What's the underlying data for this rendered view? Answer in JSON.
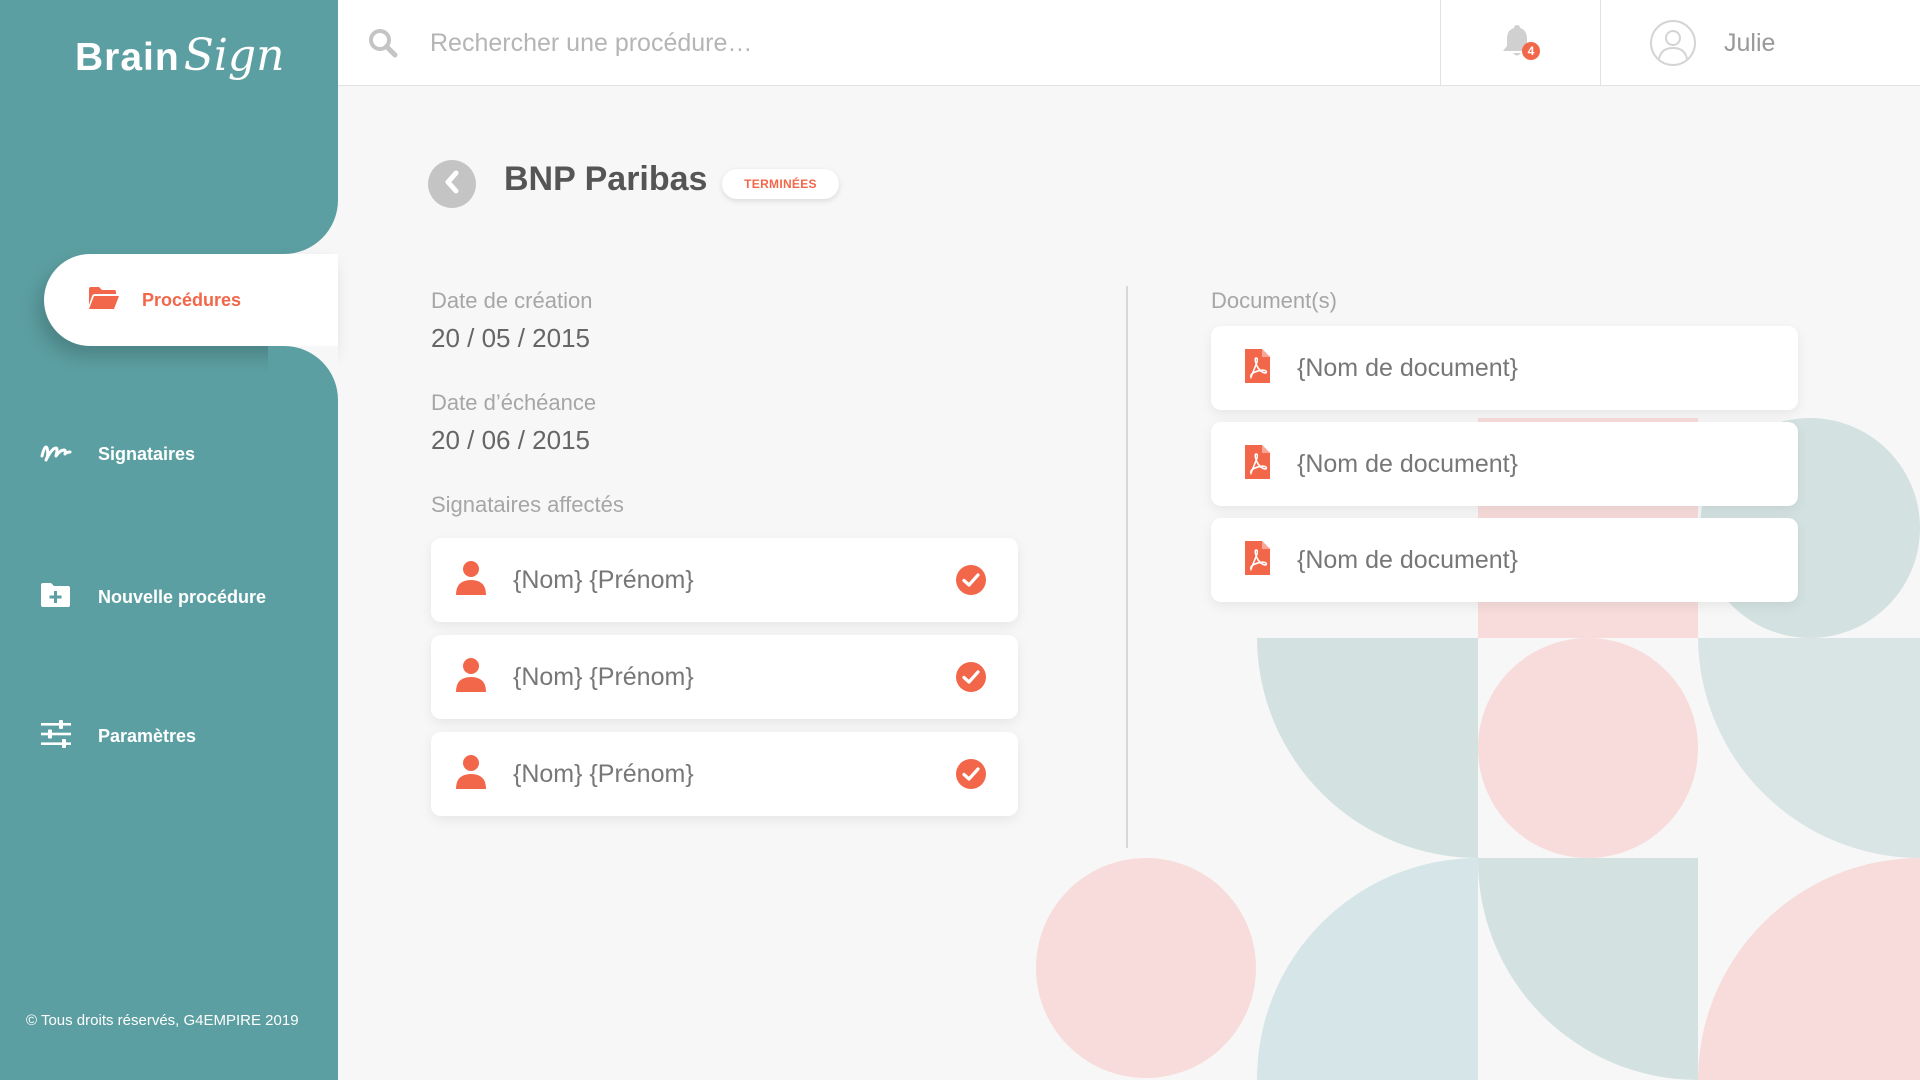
{
  "app": {
    "logo_brain": "Brain",
    "logo_sign": "Sign"
  },
  "colors": {
    "teal": "#5c9fa2",
    "accent": "#f2674a",
    "background": "#f7f7f7"
  },
  "sidebar": {
    "items": [
      {
        "label": "Procédures",
        "icon": "folder-open-icon",
        "active": true
      },
      {
        "label": "Signataires",
        "icon": "signature-icon",
        "active": false
      },
      {
        "label": "Nouvelle procédure",
        "icon": "folder-plus-icon",
        "active": false
      },
      {
        "label": "Paramètres",
        "icon": "sliders-icon",
        "active": false
      }
    ],
    "copyright": "© Tous droits réservés, G4EMPIRE 2019"
  },
  "topbar": {
    "search_placeholder": "Rechercher une procédure…",
    "notification_count": "4",
    "user_name": "Julie"
  },
  "procedure": {
    "title": "BNP Paribas",
    "status": "TERMINÉES",
    "creation_label": "Date de création",
    "creation_date": "20 / 05 / 2015",
    "due_label": "Date d’échéance",
    "due_date": "20 / 06 / 2015",
    "signers_label": "Signataires affectés",
    "signers": [
      {
        "name": "{Nom} {Prénom}",
        "signed": true
      },
      {
        "name": "{Nom} {Prénom}",
        "signed": true
      },
      {
        "name": "{Nom} {Prénom}",
        "signed": true
      }
    ],
    "documents_label": "Document(s)",
    "documents": [
      {
        "name": "{Nom de document}",
        "icon": "pdf-file-icon"
      },
      {
        "name": "{Nom de document}",
        "icon": "pdf-file-icon"
      },
      {
        "name": "{Nom de document}",
        "icon": "pdf-file-icon"
      }
    ]
  }
}
